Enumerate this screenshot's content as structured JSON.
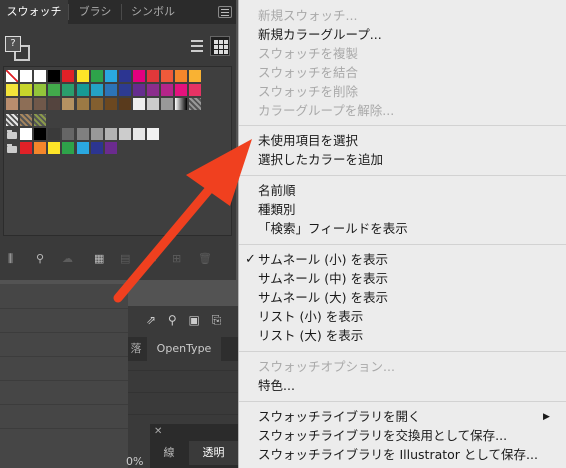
{
  "swatches_panel": {
    "tabs": [
      {
        "label": "スウォッチ"
      },
      {
        "label": "ブラシ"
      },
      {
        "label": "シンボル"
      }
    ],
    "fill_stroke_label": "?",
    "swatch_rows": [
      [
        "none",
        "#ffffff",
        "#ffffff",
        "#000000",
        "#e02127",
        "#fde428",
        "#2ea34a",
        "#2aa8e0",
        "#2c3591",
        "#e3007f",
        "#e1383a",
        "#ef5a3a",
        "#f4862b",
        "#f9b233"
      ],
      [
        "#f3e33a",
        "#c7d52b",
        "#93c43a",
        "#42aa4b",
        "#2a9e6c",
        "#169a95",
        "#24a2c6",
        "#2c74b7",
        "#2d3b90",
        "#652d8e",
        "#8b2d8c",
        "#b5258a",
        "#e4127d",
        "#e53364"
      ],
      [
        "#b98d6e",
        "#8d6e56",
        "#70584a",
        "#54443e",
        "#b49362",
        "#9c7a44",
        "#835f2f",
        "#6c4820",
        "#593a1c",
        "#eeeeee",
        "#cccccc",
        "#999999",
        "gradient",
        "pattern"
      ],
      [
        "pattern",
        "pattern",
        "pattern"
      ],
      [
        "folder",
        "#ffffff",
        "#000000",
        "#3a3a3a",
        "#666666",
        "#808080",
        "#999999",
        "#b3b3b3",
        "#cccccc",
        "#e6e6e6",
        "#f2f2f2"
      ],
      [
        "folder",
        "#e02127",
        "#f4862b",
        "#fde428",
        "#2ea34a",
        "#2aa8e0",
        "#2c3591",
        "#6b2b8e"
      ]
    ],
    "bottom_icons": [
      "library-icon",
      "kind-icon",
      "cloud-icon",
      "new-group-icon",
      "options-icon",
      "folder-icon",
      "new-swatch-icon",
      "trash-icon"
    ]
  },
  "underlying": {
    "tab_a": "落",
    "tab_b": "OpenType",
    "small_panel_close": "✕",
    "small_tab_1": "線",
    "small_tab_2": "透明",
    "percent": "0%"
  },
  "menu": {
    "items": [
      {
        "label": "新規スウォッチ...",
        "disabled": true
      },
      {
        "label": "新規カラーグループ...",
        "disabled": false
      },
      {
        "label": "スウォッチを複製",
        "disabled": true
      },
      {
        "label": "スウォッチを結合",
        "disabled": true
      },
      {
        "label": "スウォッチを削除",
        "disabled": true
      },
      {
        "label": "カラーグループを解除...",
        "disabled": true
      },
      {
        "label": "未使用項目を選択",
        "disabled": false
      },
      {
        "label": "選択したカラーを追加",
        "disabled": false
      },
      {
        "label": "名前順",
        "disabled": false
      },
      {
        "label": "種類別",
        "disabled": false
      },
      {
        "label": "「検索」フィールドを表示",
        "disabled": false
      },
      {
        "label": "サムネール (小) を表示",
        "disabled": false,
        "checked": true
      },
      {
        "label": "サムネール (中) を表示",
        "disabled": false
      },
      {
        "label": "サムネール (大) を表示",
        "disabled": false
      },
      {
        "label": "リスト (小) を表示",
        "disabled": false
      },
      {
        "label": "リスト (大) を表示",
        "disabled": false
      },
      {
        "label": "スウォッチオプション...",
        "disabled": true
      },
      {
        "label": "特色...",
        "disabled": false
      },
      {
        "label": "スウォッチライブラリを開く",
        "disabled": false,
        "submenu": true
      },
      {
        "label": "スウォッチライブラリを交換用として保存...",
        "disabled": false
      },
      {
        "label": "スウォッチライブラリを Illustrator として保存...",
        "disabled": false
      }
    ],
    "check_mark": "✓",
    "submenu_arrow": "▶"
  },
  "annotation": {
    "color": "#f0401f",
    "type": "arrow"
  }
}
